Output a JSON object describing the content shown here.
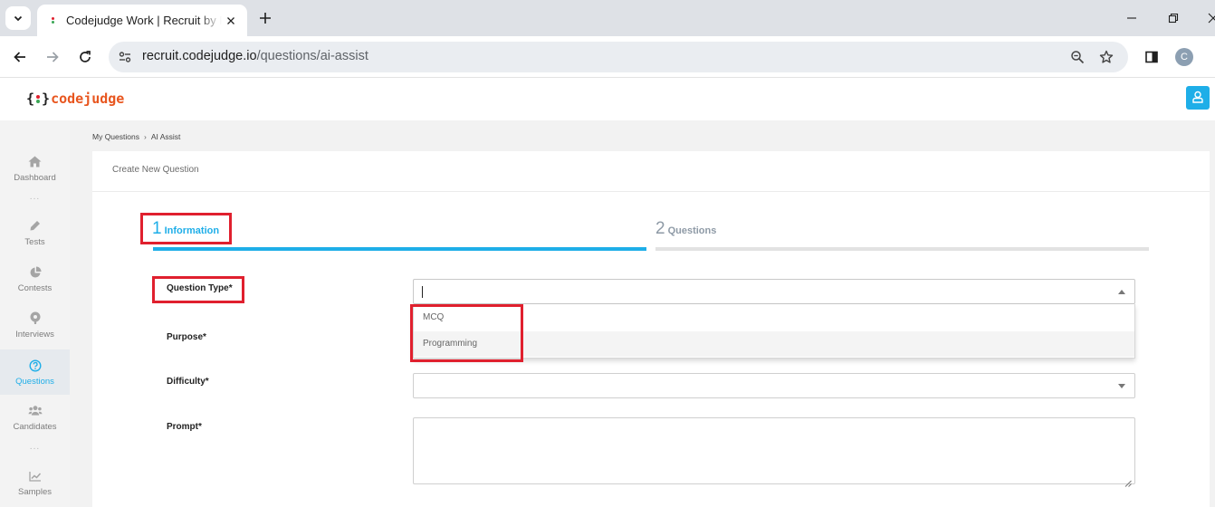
{
  "browser": {
    "tab_title": "Codejudge Work | Recruit by Re",
    "url_host": "recruit.codejudge.io",
    "url_path": "/questions/ai-assist",
    "profile_initial": "C"
  },
  "app": {
    "logo_open": "{",
    "logo_close": "}",
    "logo_word": "codejudge",
    "brand_color": "#e8561f",
    "accent_color": "#1eaee8"
  },
  "sidebar": {
    "items": [
      {
        "label": "Dashboard",
        "icon": "home-icon"
      },
      {
        "label": "Tests",
        "icon": "pencil-icon"
      },
      {
        "label": "Contests",
        "icon": "pie-chart-icon"
      },
      {
        "label": "Interviews",
        "icon": "podcast-icon"
      },
      {
        "label": "Questions",
        "icon": "question-circle-icon",
        "active": true
      },
      {
        "label": "Candidates",
        "icon": "users-icon"
      },
      {
        "label": "Samples",
        "icon": "line-chart-icon"
      }
    ],
    "separator": "..."
  },
  "breadcrumb": {
    "items": [
      "My Questions",
      "AI Assist"
    ],
    "separator": "›"
  },
  "card": {
    "title": "Create New Question"
  },
  "steps": [
    {
      "number": "1",
      "label": "Information",
      "active": true
    },
    {
      "number": "2",
      "label": "Questions",
      "active": false
    }
  ],
  "form": {
    "question_type": {
      "label": "Question Type*",
      "value": ""
    },
    "purpose": {
      "label": "Purpose*"
    },
    "difficulty": {
      "label": "Difficulty*",
      "value": ""
    },
    "prompt": {
      "label": "Prompt*",
      "value": ""
    }
  },
  "dropdown": {
    "options": [
      "MCQ",
      "Programming"
    ],
    "hovered_index": 1
  },
  "annotation_color": "#e0202e"
}
